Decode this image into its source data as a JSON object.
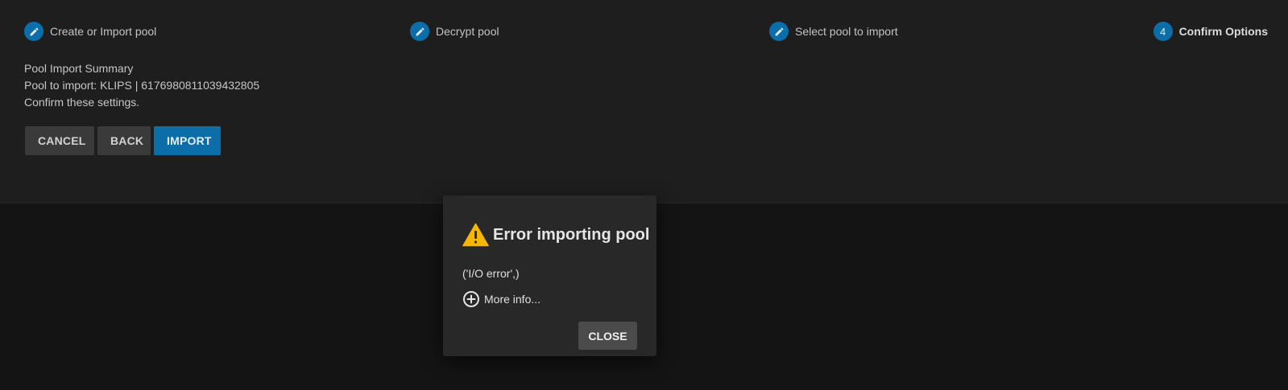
{
  "stepper": {
    "steps": [
      {
        "label": "Create or Import pool",
        "icon": "pencil-icon",
        "state": "done"
      },
      {
        "label": "Decrypt pool",
        "icon": "pencil-icon",
        "state": "done"
      },
      {
        "label": "Select pool to import",
        "icon": "pencil-icon",
        "state": "done"
      },
      {
        "label": "Confirm Options",
        "number": "4",
        "state": "active"
      }
    ]
  },
  "summary": {
    "heading": "Pool Import Summary",
    "pool_line": "Pool to import: KLIPS | 6176980811039432805",
    "confirm_text": "Confirm these settings."
  },
  "actions": {
    "cancel_label": "CANCEL",
    "back_label": "BACK",
    "import_label": "IMPORT"
  },
  "dialog": {
    "icon": "warning-icon",
    "title": "Error importing pool",
    "message": "('I/O error',)",
    "more_info_icon": "plus-circle-icon",
    "more_info_label": "More info...",
    "close_label": "CLOSE"
  },
  "colors": {
    "accent": "#0b6ea8",
    "warning": "#f5b800",
    "page_background": "#141414",
    "panel_background": "#1e1e1e",
    "dialog_background": "#282828"
  }
}
